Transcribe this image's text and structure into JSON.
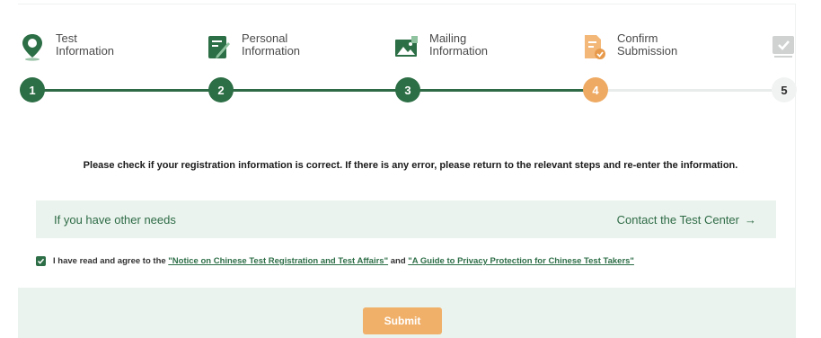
{
  "steps": [
    {
      "number": "1",
      "label": "Test\nInformation",
      "icon": "location-pin-icon",
      "state": "done"
    },
    {
      "number": "2",
      "label": "Personal\nInformation",
      "icon": "edit-form-icon",
      "state": "done"
    },
    {
      "number": "3",
      "label": "Mailing\nInformation",
      "icon": "image-mail-icon",
      "state": "done"
    },
    {
      "number": "4",
      "label": "Confirm\nSubmission",
      "icon": "document-check-icon",
      "state": "current"
    },
    {
      "number": "5",
      "label": "",
      "icon": "checked-screen-icon",
      "state": "todo"
    }
  ],
  "notice": "Please check if your registration information is correct. If there is any error, please return to the relevant steps and re-enter the information.",
  "needs": {
    "text": "If you have other needs",
    "contact": "Contact the Test Center",
    "arrow": "→"
  },
  "agreement": {
    "checked": true,
    "prefix": "I have read and agree to the",
    "link1": "\"Notice on Chinese Test Registration and Test Affairs\"",
    "conjunction": "and",
    "link2": "\"A Guide to Privacy Protection for Chinese Test Takers\""
  },
  "submit_label": "Submit",
  "colors": {
    "primary_green": "#2c6e45",
    "accent_orange": "#eeaa63",
    "light_green_bg": "#eaf3ed"
  }
}
